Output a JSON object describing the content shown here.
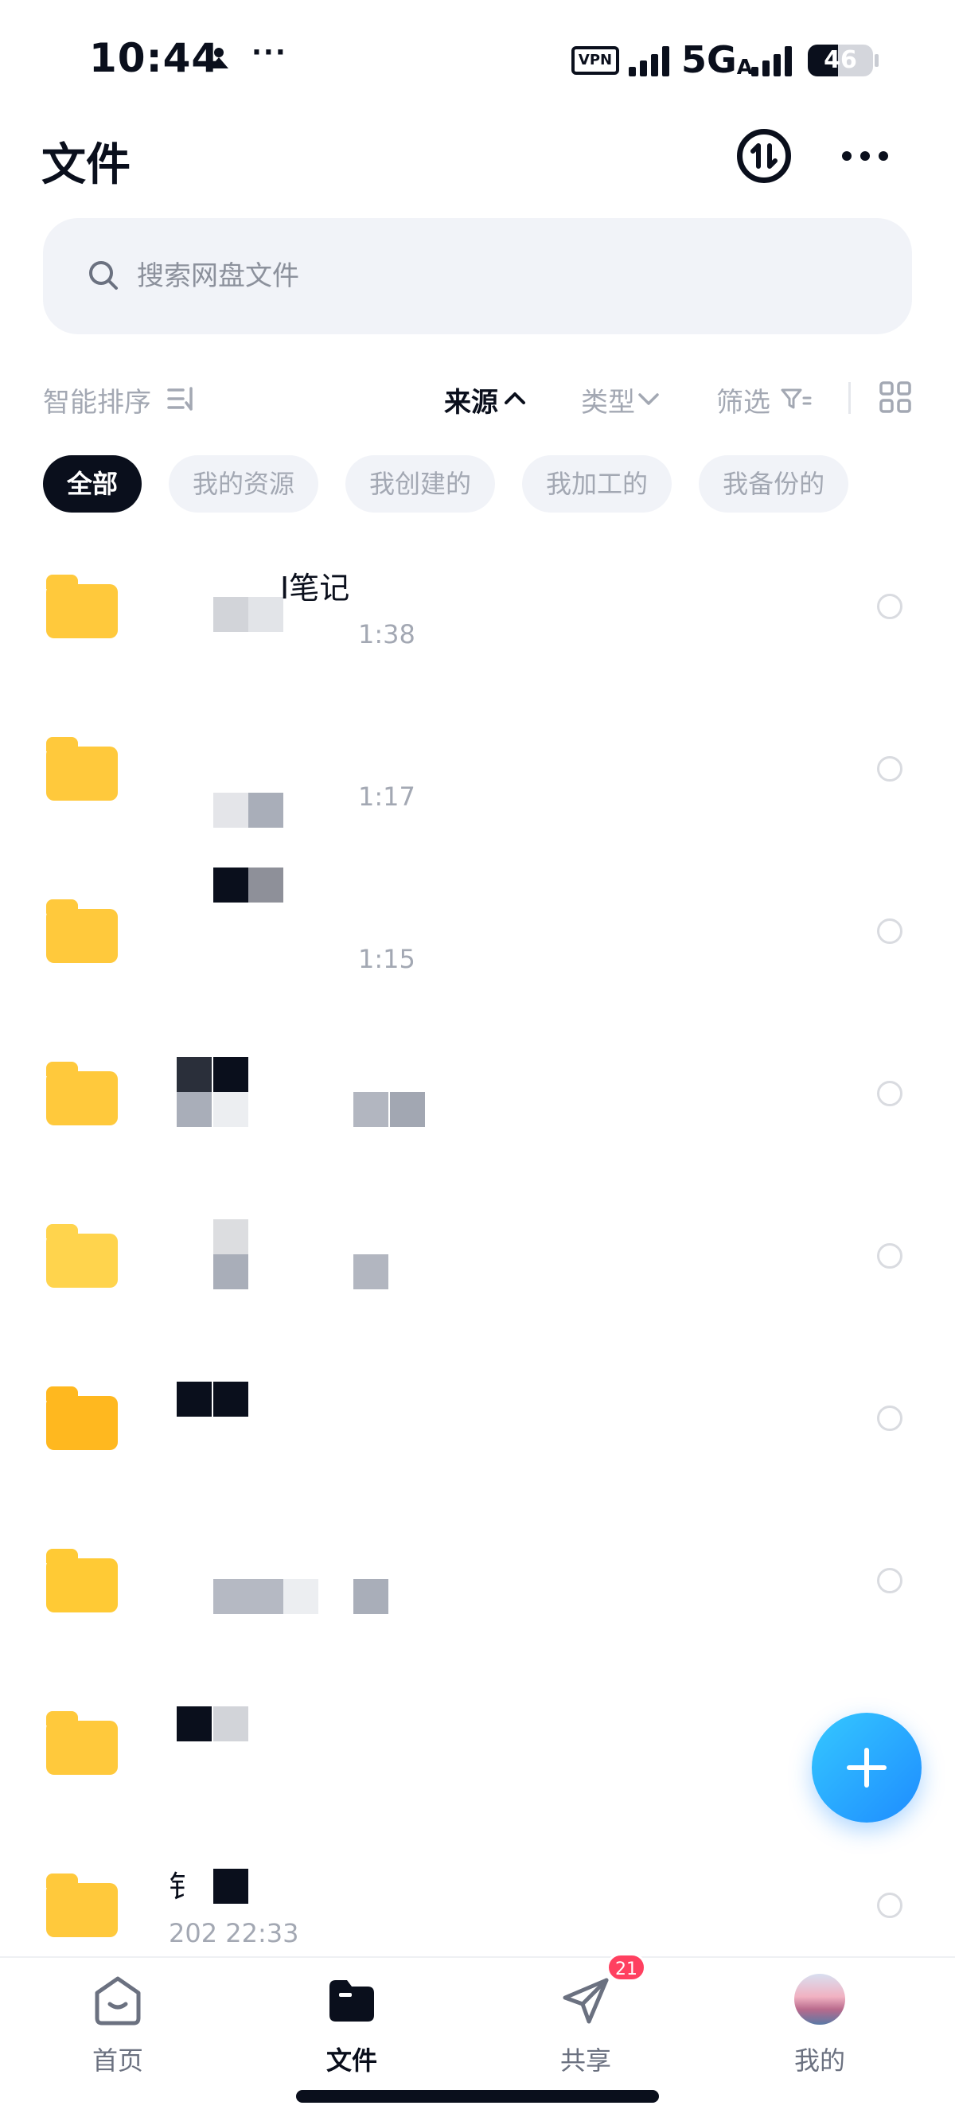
{
  "status_bar": {
    "time": "10:44",
    "dots": "···",
    "vpn": "VPN",
    "network": "5G",
    "network_sub": "A",
    "battery": "46",
    "battery_level": 0.46
  },
  "header": {
    "title": "文件",
    "sync_icon": "transfer-icon",
    "more_icon": "more-icon"
  },
  "search": {
    "placeholder": "搜索网盘文件",
    "icon": "search-icon"
  },
  "sort": {
    "smart": "智能排序",
    "source": "来源",
    "type": "类型",
    "filter": "筛选"
  },
  "chips": [
    "全部",
    "我的资源",
    "我创建的",
    "我加工的",
    "我备份的"
  ],
  "files": [
    {
      "name": "I笔记",
      "meta": "1:38",
      "color": "#FFC93C"
    },
    {
      "name": "",
      "meta": "1:17",
      "color": "#FFC93C"
    },
    {
      "name": "",
      "meta": "1:15",
      "color": "#FFC93C"
    },
    {
      "name": "",
      "meta": "",
      "color": "#FFC93C"
    },
    {
      "name": "",
      "meta": "",
      "color": "#FFD44D"
    },
    {
      "name": "",
      "meta": "",
      "color": "#FFB81F"
    },
    {
      "name": "",
      "meta": "",
      "color": "#FFCA35"
    },
    {
      "name": "",
      "meta": "",
      "color": "#FFC93C"
    },
    {
      "name": "钅",
      "meta": "202  22:33",
      "color": "#FFC93C"
    }
  ],
  "bottom_nav": [
    {
      "label": "首页",
      "icon": "home-icon"
    },
    {
      "label": "文件",
      "icon": "folder-icon"
    },
    {
      "label": "共享",
      "icon": "send-icon",
      "badge": "21"
    },
    {
      "label": "我的",
      "icon": "avatar"
    }
  ],
  "colors": {
    "accent": "#1E8CFF",
    "text": "#0A0F1C",
    "muted": "#A3A8B3",
    "folder": "#FFC93C",
    "badge": "#FF4060"
  }
}
